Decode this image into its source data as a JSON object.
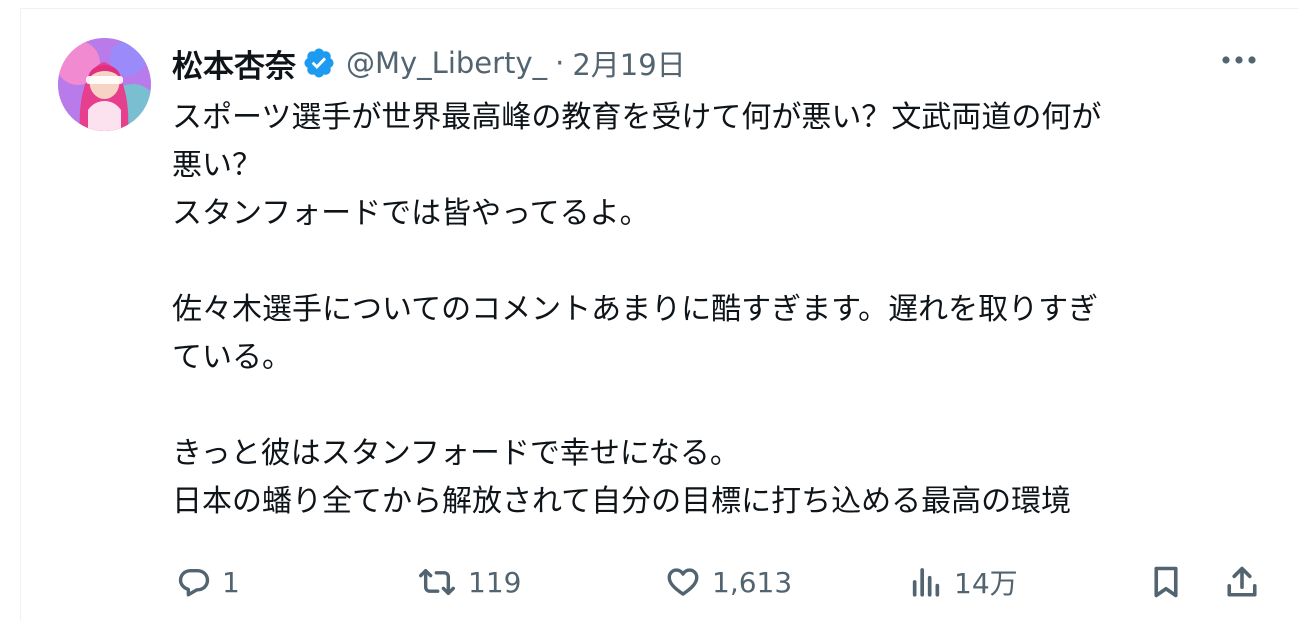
{
  "tweet": {
    "author": {
      "display_name": "松本杏奈",
      "handle": "@My_Liberty_",
      "verified": true
    },
    "separator": "·",
    "timestamp": "2月19日",
    "lines": [
      "スポーツ選手が世界最高峰の教育を受けて何が悪い？文武両道の何が",
      "悪い？",
      "スタンフォードでは皆やってるよ。",
      "",
      "佐々木選手についてのコメントあまりに酷すぎます。遅れを取りすぎ",
      "ている。",
      "",
      "きっと彼はスタンフォードで幸せになる。",
      "日本の蟠り全てから解放されて自分の目標に打ち込める最高の環境"
    ],
    "stats": {
      "replies": "1",
      "retweets": "119",
      "likes": "1,613",
      "views": "14万"
    }
  },
  "icons": {
    "verified": "verified-badge-icon",
    "more": "more-options-icon",
    "reply": "reply-icon",
    "retweet": "retweet-icon",
    "like": "heart-icon",
    "views": "views-chart-icon",
    "bookmark": "bookmark-icon",
    "share": "share-icon"
  },
  "colors": {
    "text_primary": "#0f1419",
    "text_secondary": "#536471",
    "verified_blue": "#1d9bf0",
    "divider": "#eff3f4"
  }
}
